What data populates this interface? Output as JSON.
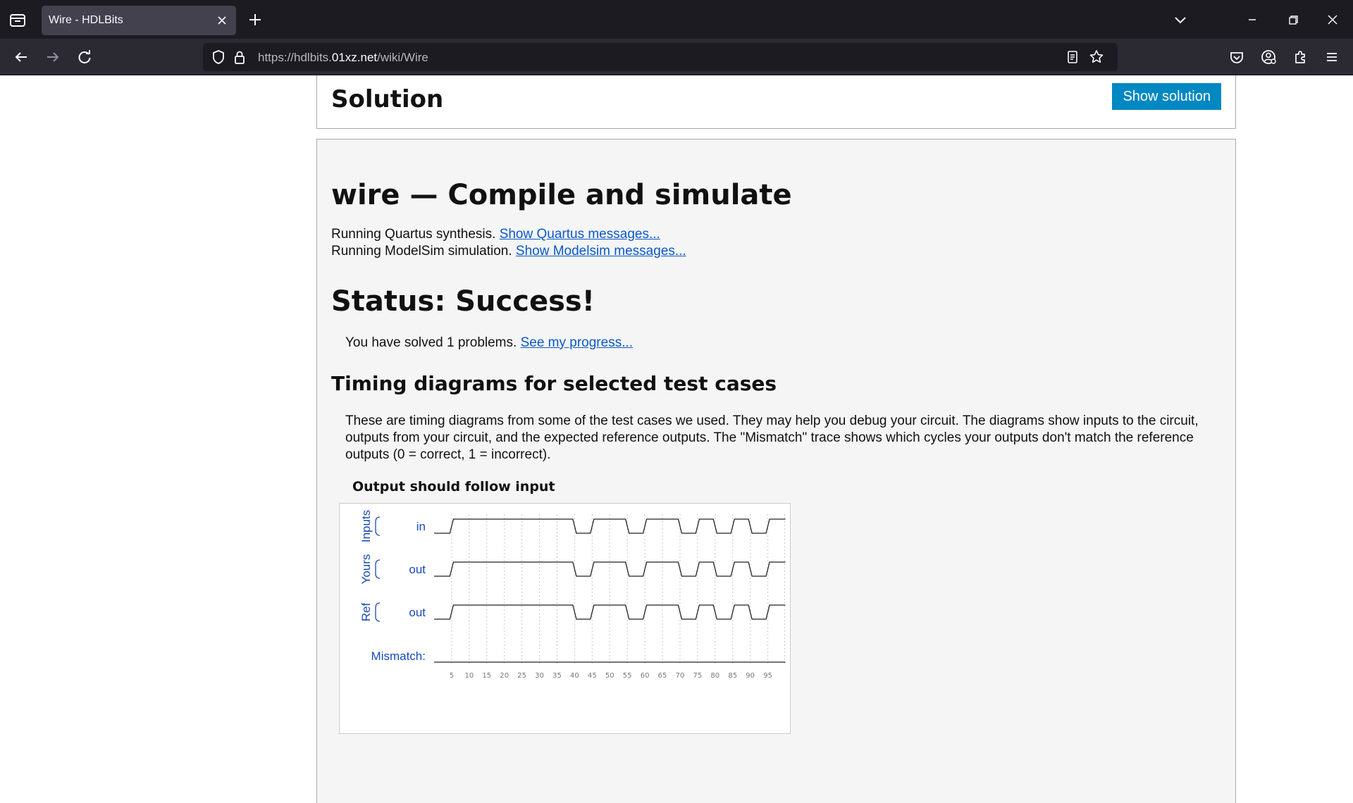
{
  "browser": {
    "tab_title": "Wire - HDLBits",
    "url_prefix": "https://hdlbits.",
    "url_domain": "01xz.net",
    "url_path": "/wiki/Wire"
  },
  "solution": {
    "title": "Solution",
    "button_label": "Show solution"
  },
  "result": {
    "title": "wire — Compile and simulate",
    "quartus_text": "Running Quartus synthesis.",
    "quartus_link": "Show Quartus messages...",
    "modelsim_text": "Running ModelSim simulation.",
    "modelsim_link": "Show Modelsim messages...",
    "status": "Status: Success!",
    "solved_text": "You have solved 1 problems.",
    "progress_link": "See my progress...",
    "timing_heading": "Timing diagrams for selected test cases",
    "timing_desc": "These are timing diagrams from some of the test cases we used. They may help you debug your circuit. The diagrams show inputs to the circuit, outputs from your circuit, and the expected reference outputs. The \"Mismatch\" trace shows which cycles your outputs don't match the reference outputs (0 = correct, 1 = incorrect)."
  },
  "waveform": {
    "title": "Output should follow input",
    "groups": [
      "Inputs",
      "Yours",
      "Ref"
    ],
    "signal_labels": [
      "in",
      "out",
      "out"
    ],
    "mismatch_label": "Mismatch:",
    "time_ticks": [
      "5",
      "10",
      "15",
      "20",
      "25",
      "30",
      "35",
      "40",
      "45",
      "50",
      "55",
      "60",
      "65",
      "70",
      "75",
      "80",
      "85",
      "90",
      "95"
    ],
    "time_step_ns": 5,
    "t_end_ns": 100,
    "edges_ns": [
      "5:1",
      "40:0",
      "45:1",
      "55:0",
      "60:1",
      "70:0",
      "75:1",
      "80:0",
      "85:1",
      "90:0",
      "95:1"
    ],
    "mismatch_edges_ns": []
  }
}
